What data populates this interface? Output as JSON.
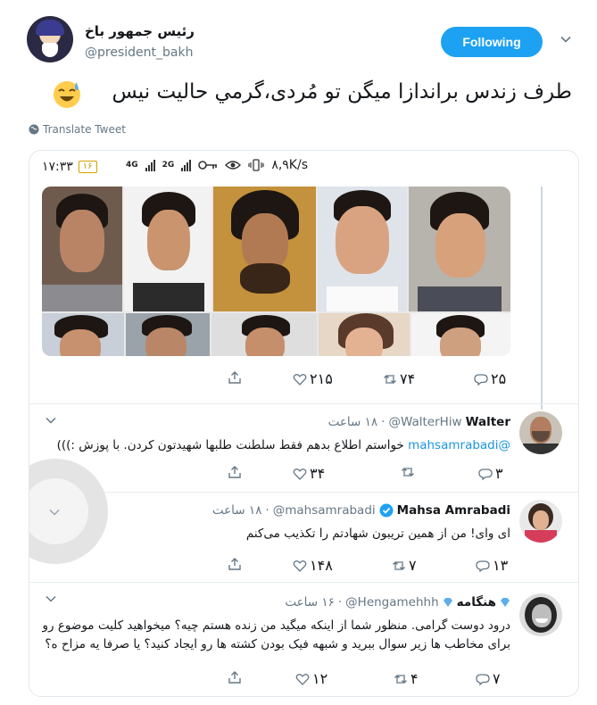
{
  "tweet": {
    "display_name": "رئیس جمهور باخ",
    "handle": "@president_bakh",
    "follow_label": "Following",
    "text": "طرف زندس براندازا میگن تو مُردی،گرمي حاليت نيس",
    "translate_label": "Translate Tweet"
  },
  "embedded": {
    "status_bar": {
      "time": "۱۷:۳۳",
      "battery": "۱۶",
      "gen1": "4G",
      "gen2": "2G",
      "speed": "۸,۹K/s"
    },
    "top_tweet_actions": {
      "retweets": "۷۴",
      "likes": "۲۱۵",
      "replies": "۲۵"
    },
    "replies": [
      {
        "name": "Walter",
        "handle": "@WalterHiw",
        "time": "۱۸ ساعت",
        "mention": "@mahsamrabadi",
        "text_line1": "خواستم اطلاع بدهم فقط سلطنت طلبها شهیدتون کردن. با پوزش :)))",
        "replies": "۳",
        "retweets": "",
        "likes": "۳۴"
      },
      {
        "name": "Mahsa Amrabadi",
        "handle": "@mahsamrabadi",
        "time": "۱۸ ساعت",
        "text_line1": "ای وای! من از همین تریبون شهادتم را تکذیب می‌کنم",
        "replies": "۱۳",
        "retweets": "۷",
        "likes": "۱۴۸"
      },
      {
        "name": "هنگامه",
        "handle": "@Hengamehhh",
        "time": "۱۶ ساعت",
        "text_line1": "درود دوست گرامی. منظور شما از اینکه میگید من زنده هستم چیه؟ میخواهید کلیت موضوع رو",
        "text_line2": "برای مخاطب ها زیر سوال ببرید و شبهه فیک بودن کشته ها رو ایجاد کنید؟ یا صرفا یه مزاح ه؟",
        "replies": "۷",
        "retweets": "۴",
        "likes": "۱۲"
      }
    ]
  },
  "colors": {
    "accent": "#1da1f2",
    "link": "#1b95e0",
    "muted": "#657786"
  }
}
